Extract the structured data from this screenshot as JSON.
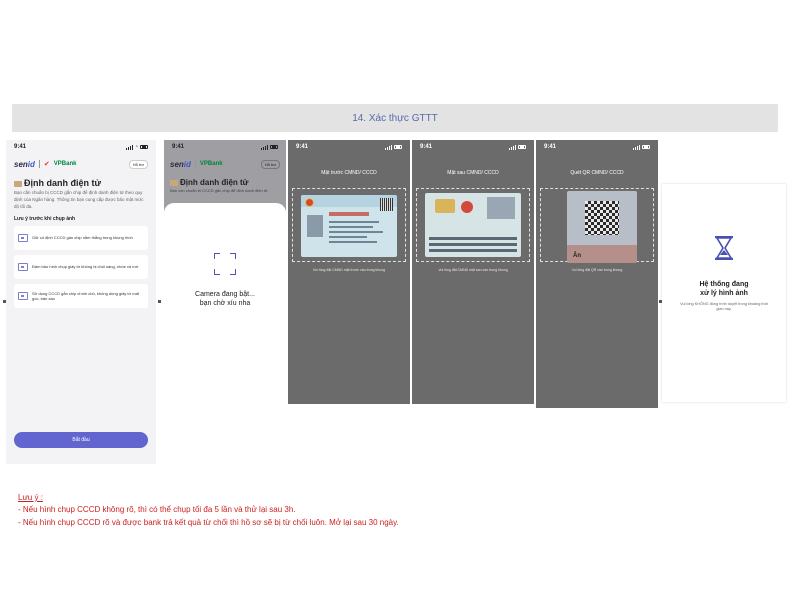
{
  "header": {
    "title": "14. Xác thực GTTT"
  },
  "status_time": "9:41",
  "screen1": {
    "brand": {
      "senid_a": "sen",
      "senid_b": "id",
      "partner": "VPBank"
    },
    "help_label": "Hỗ trợ",
    "title": "Định danh điện tử",
    "description": "Bạn cần chuẩn bị CCCD gắn chip để định danh điện tử theo quy định của Ngân hàng. Thông tin bạn cung cấp được bảo mật mức độ tối đa.",
    "tips_heading": "Lưu ý trước khi chụp ảnh",
    "tips": [
      {
        "icon": "id-frame-icon",
        "text": "Giữ cố định CCCD gần chip nằm thẳng trong khung hình"
      },
      {
        "icon": "id-frame-icon",
        "text": "Đảm bảo hình chụp giấy tờ không bị chói sáng, nhòe và mờ"
      },
      {
        "icon": "id-frame-icon",
        "text": "Sử dụng CCCD gắn chip chính chủ, không dùng giấy tờ mất góc, bản sao"
      }
    ],
    "start_button": "Bắt đầu"
  },
  "screen2": {
    "help_label": "Hỗ trợ",
    "title": "Định danh điện tử",
    "description": "Bạn cần chuẩn bị CCCD gắn chip để định danh điện tử",
    "camera_line1": "Camera đang bật...",
    "camera_line2": "bạn chờ xíu nha"
  },
  "screen3": {
    "title": "Mặt trước CMND/ CCCD",
    "hint": "Vui lòng đặt CMND mặt trước vào trong khung"
  },
  "screen4": {
    "title": "Mặt sau CMND/ CCCD",
    "hint": "Vui lòng đặt CMND mặt sau vào trong khung"
  },
  "screen5": {
    "title": "Quét QR CMND/ CCCD",
    "hint": "Vui lòng đặt QR vào trong khung",
    "card_text": "Ân"
  },
  "screen6": {
    "title_line1": "Hệ thống đang",
    "title_line2": "xử lý hình ảnh",
    "description": "Vui lòng KHÔNG đóng trình duyệt trong khoảng thời gian này."
  },
  "notes": {
    "heading": "Lưu ý :",
    "items": [
      "- Nếu hình chụp CCCD không rõ, thì có thể chụp tối đa 5 lần và thử lại sau 3h.",
      "- Nếu hình chụp CCCD rõ và được bank trả kết quả từ chối thì hồ sơ sẽ bị từ chối luôn. Mở lại sau 30 ngày."
    ]
  },
  "colors": {
    "primary": "#6264cf",
    "capture_bg": "#6b6b6b",
    "note_red": "#cc1f1f",
    "title_text": "#5a6aa8"
  }
}
